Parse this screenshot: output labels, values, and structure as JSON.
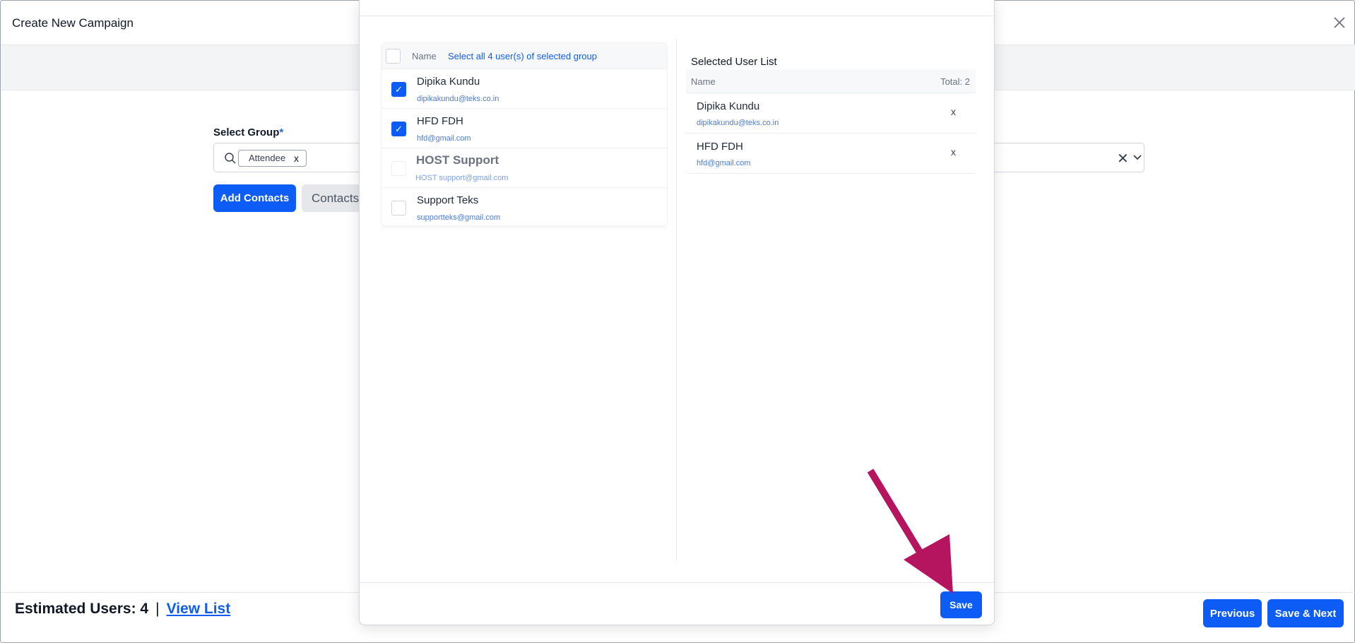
{
  "header": {
    "title": "Create New Campaign"
  },
  "form": {
    "group_label": "Select Group",
    "required_mark": "*",
    "chip_label": "Attendee",
    "chip_remove": "x",
    "clear": "✕",
    "add_contacts": "Add Contacts",
    "contacts_tab": "Contacts"
  },
  "footer": {
    "estimated_label": "Estimated Users: 4",
    "separator": "|",
    "view_list": "View List",
    "previous": "Previous",
    "save_next": "Save & Next"
  },
  "modal": {
    "left": {
      "name_header": "Name",
      "select_all": "Select all 4 user(s) of selected group",
      "users": [
        {
          "name": "Dipika Kundu",
          "email": "dipikakundu@teks.co.in",
          "checked": true,
          "disabled": false
        },
        {
          "name": "HFD FDH",
          "email": "hfd@gmail.com",
          "checked": true,
          "disabled": false
        },
        {
          "name": "HOST Support",
          "email": "HOST support@gmail.com",
          "checked": false,
          "disabled": true
        },
        {
          "name": "Support Teks",
          "email": "supportteks@gmail.com",
          "checked": false,
          "disabled": false
        }
      ]
    },
    "right": {
      "title": "Selected User List",
      "name_header": "Name",
      "total": "Total: 2",
      "users": [
        {
          "name": "Dipika Kundu",
          "email": "dipikakundu@teks.co.in",
          "remove": "x"
        },
        {
          "name": "HFD FDH",
          "email": "hfd@gmail.com",
          "remove": "x"
        }
      ]
    },
    "save": "Save"
  },
  "colors": {
    "primary": "#0d5cf5",
    "annotation_arrow": "#b5145f"
  },
  "icons": {
    "close": "close-icon",
    "search": "search-icon",
    "chevron": "chevron-down-icon",
    "check": "check-icon",
    "arrow": "annotation-arrow"
  }
}
